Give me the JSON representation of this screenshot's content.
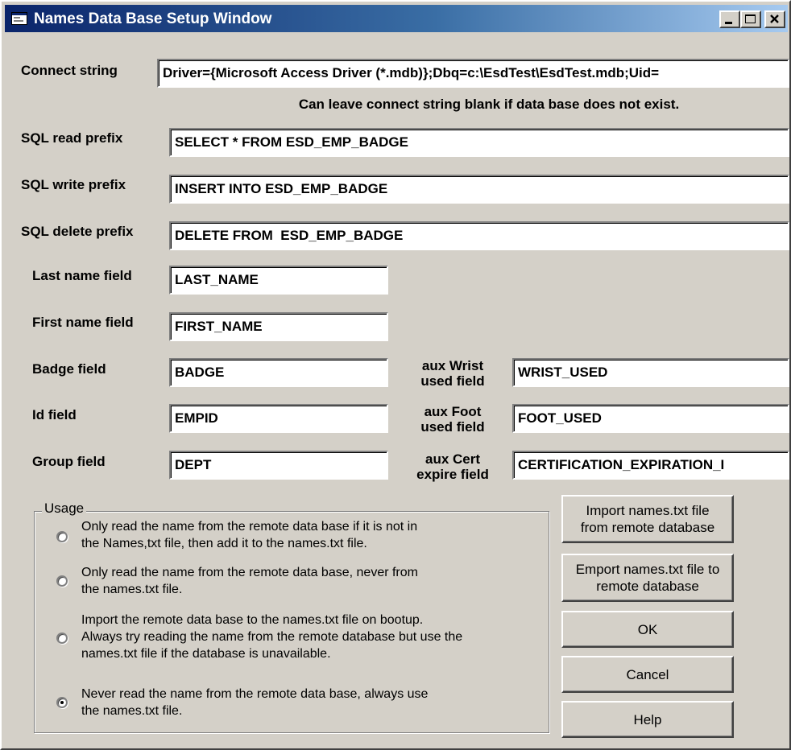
{
  "window": {
    "title": "Names Data Base Setup Window",
    "titlebar_colors": [
      "#0a246a",
      "#a6caf0"
    ],
    "face_color": "#d4d0c8",
    "caption_buttons": [
      "minimize-icon",
      "maximize-icon",
      "close-icon"
    ]
  },
  "connect": {
    "label": "Connect string",
    "value": "Driver={Microsoft Access Driver (*.mdb)};Dbq=c:\\EsdTest\\EsdTest.mdb;Uid=",
    "hint": "Can leave connect string blank if data base does not exist."
  },
  "sql": {
    "read_label": "SQL read prefix",
    "read_value": "SELECT * FROM ESD_EMP_BADGE",
    "write_label": "SQL write prefix",
    "write_value": "INSERT INTO ESD_EMP_BADGE",
    "delete_label": "SQL delete prefix",
    "delete_value": "DELETE FROM  ESD_EMP_BADGE"
  },
  "fields": {
    "last_name_label": "Last name field",
    "last_name_value": "LAST_NAME",
    "first_name_label": "First name field",
    "first_name_value": "FIRST_NAME",
    "badge_label": "Badge field",
    "badge_value": "BADGE",
    "id_label": "Id field",
    "id_value": "EMPID",
    "group_label": "Group field",
    "group_value": "DEPT"
  },
  "aux": {
    "wrist_label_1": "aux Wrist",
    "wrist_label_2": "used field",
    "wrist_value": "WRIST_USED",
    "foot_label_1": "aux Foot",
    "foot_label_2": "used field",
    "foot_value": "FOOT_USED",
    "cert_label_1": "aux Cert",
    "cert_label_2": "expire field",
    "cert_value": "CERTIFICATION_EXPIRATION_I"
  },
  "usage": {
    "title": "Usage",
    "selected_index": 3,
    "options": [
      {
        "lines": [
          "Only read the name from the remote data base if it is not in",
          "the Names,txt file, then add it to the names.txt file."
        ]
      },
      {
        "lines": [
          "Only read the name from the remote data base, never from",
          "the names.txt file."
        ]
      },
      {
        "lines": [
          "Import the remote data base to the names.txt file on bootup.",
          "Always try reading the name from the remote database but use the",
          "names.txt file if the database is unavailable."
        ]
      },
      {
        "lines": [
          "Never read the name from the remote data base, always use",
          "the names.txt file."
        ]
      }
    ]
  },
  "buttons": {
    "import_line1": "Import names.txt file",
    "import_line2": "from remote database",
    "export_line1": "Emport names.txt file to",
    "export_line2": "remote database",
    "ok": "OK",
    "cancel": "Cancel",
    "help": "Help"
  }
}
